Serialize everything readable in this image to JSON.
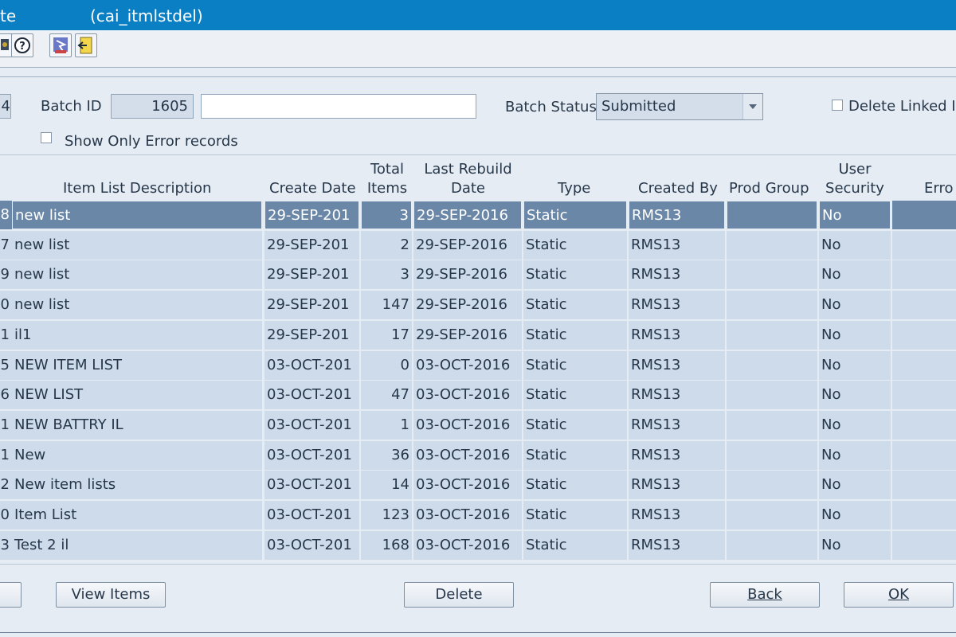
{
  "window": {
    "title_left": "te",
    "title_module": "(cai_itmlstdel)"
  },
  "toolbar": {
    "icons": [
      "save-icon",
      "help-icon",
      "navigate-icon",
      "exit-icon"
    ]
  },
  "form": {
    "partial_value": "4",
    "batch_id_label": "Batch ID",
    "batch_id_value": "1605",
    "batch_desc_value": "",
    "batch_status_label": "Batch Status",
    "batch_status_value": "Submitted",
    "delete_linked_label": "Delete Linked I",
    "show_errors_label": "Show Only Error records"
  },
  "table": {
    "headers": {
      "desc": "Item List Description",
      "create_date": "Create Date",
      "total_items_1": "Total",
      "total_items_2": "Items",
      "last_rebuild_1": "Last Rebuild",
      "last_rebuild_2": "Date",
      "type": "Type",
      "created_by": "Created By",
      "prod_group": "Prod Group",
      "user_security_1": "User",
      "user_security_2": "Security",
      "error": "Erro"
    },
    "rows": [
      {
        "id": "8",
        "desc": "new list",
        "create_date": "29-SEP-201",
        "total": "3",
        "rebuild": "29-SEP-2016",
        "type": "Static",
        "created_by": "RMS13",
        "prod_group": "",
        "security": "No",
        "error": ""
      },
      {
        "id": "7",
        "desc": "new list",
        "create_date": "29-SEP-201",
        "total": "2",
        "rebuild": "29-SEP-2016",
        "type": "Static",
        "created_by": "RMS13",
        "prod_group": "",
        "security": "No",
        "error": ""
      },
      {
        "id": "9",
        "desc": "new list",
        "create_date": "29-SEP-201",
        "total": "3",
        "rebuild": "29-SEP-2016",
        "type": "Static",
        "created_by": "RMS13",
        "prod_group": "",
        "security": "No",
        "error": ""
      },
      {
        "id": "0",
        "desc": "new list",
        "create_date": "29-SEP-201",
        "total": "147",
        "rebuild": "29-SEP-2016",
        "type": "Static",
        "created_by": "RMS13",
        "prod_group": "",
        "security": "No",
        "error": ""
      },
      {
        "id": "1",
        "desc": "il1",
        "create_date": "29-SEP-201",
        "total": "17",
        "rebuild": "29-SEP-2016",
        "type": "Static",
        "created_by": "RMS13",
        "prod_group": "",
        "security": "No",
        "error": ""
      },
      {
        "id": "5",
        "desc": "NEW ITEM LIST",
        "create_date": "03-OCT-201",
        "total": "0",
        "rebuild": "03-OCT-2016",
        "type": "Static",
        "created_by": "RMS13",
        "prod_group": "",
        "security": "No",
        "error": ""
      },
      {
        "id": "6",
        "desc": "NEW LIST",
        "create_date": "03-OCT-201",
        "total": "47",
        "rebuild": "03-OCT-2016",
        "type": "Static",
        "created_by": "RMS13",
        "prod_group": "",
        "security": "No",
        "error": ""
      },
      {
        "id": "1",
        "desc": "NEW BATTRY IL",
        "create_date": "03-OCT-201",
        "total": "1",
        "rebuild": "03-OCT-2016",
        "type": "Static",
        "created_by": "RMS13",
        "prod_group": "",
        "security": "No",
        "error": ""
      },
      {
        "id": "1",
        "desc": "New",
        "create_date": "03-OCT-201",
        "total": "36",
        "rebuild": "03-OCT-2016",
        "type": "Static",
        "created_by": "RMS13",
        "prod_group": "",
        "security": "No",
        "error": ""
      },
      {
        "id": "2",
        "desc": "New item lists",
        "create_date": "03-OCT-201",
        "total": "14",
        "rebuild": "03-OCT-2016",
        "type": "Static",
        "created_by": "RMS13",
        "prod_group": "",
        "security": "No",
        "error": ""
      },
      {
        "id": "0",
        "desc": "Item List",
        "create_date": "03-OCT-201",
        "total": "123",
        "rebuild": "03-OCT-2016",
        "type": "Static",
        "created_by": "RMS13",
        "prod_group": "",
        "security": "No",
        "error": ""
      },
      {
        "id": "3",
        "desc": "Test 2 il",
        "create_date": "03-OCT-201",
        "total": "168",
        "rebuild": "03-OCT-2016",
        "type": "Static",
        "created_by": "RMS13",
        "prod_group": "",
        "security": "No",
        "error": ""
      }
    ],
    "selected_row": 0
  },
  "buttons": {
    "partial": "",
    "view_items": "View Items",
    "delete": "Delete",
    "back": "Back",
    "ok": "OK"
  }
}
